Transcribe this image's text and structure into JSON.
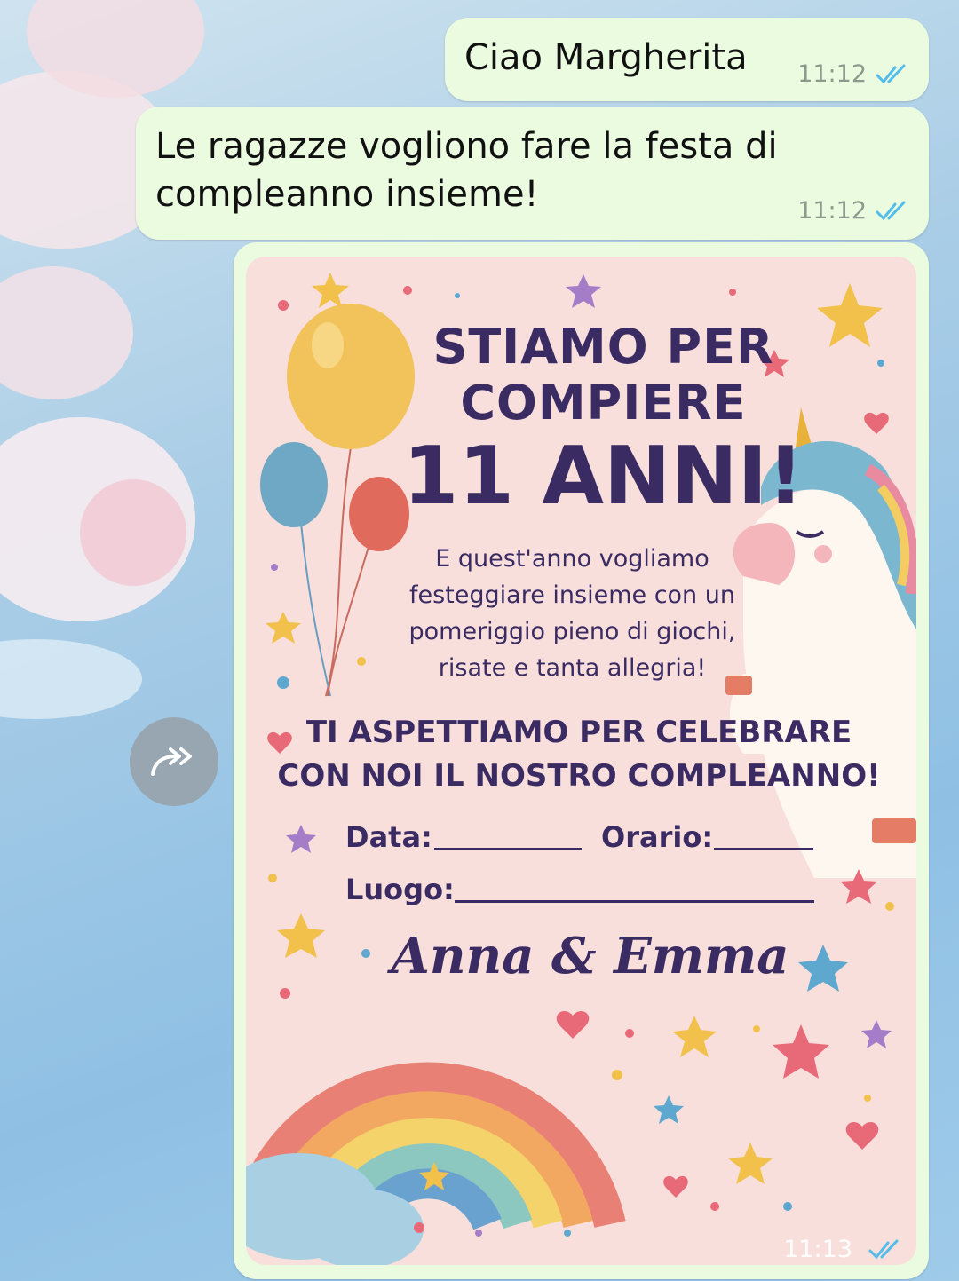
{
  "messages": [
    {
      "text": "Ciao Margherita",
      "time": "11:12",
      "status": "read"
    },
    {
      "text_line1": "Le ragazze vogliono fare la festa di",
      "text_line2": "compleanno insieme!",
      "time": "11:12",
      "status": "read"
    },
    {
      "type": "image",
      "time": "11:13",
      "status": "read"
    }
  ],
  "invite": {
    "title_line1": "STIAMO PER",
    "title_line2": "COMPIERE",
    "title_line3": "11 ANNI!",
    "body_lines": [
      "E quest'anno vogliamo",
      "festeggiare insieme con un",
      "pomeriggio pieno di giochi,",
      "risate e tanta allegria!"
    ],
    "celebrate_line1": "TI ASPETTIAMO PER CELEBRARE",
    "celebrate_line2": "CON NOI IL NOSTRO COMPLEANNO!",
    "data_label": "Data:",
    "orario_label": "Orario:",
    "luogo_label": "Luogo:",
    "names": "Anna & Emma"
  },
  "icons": {
    "forward": "forward-icon",
    "ticks": "double-check-icon"
  },
  "colors": {
    "bubble": "#eafbe0",
    "tick_read": "#53bdeb",
    "invite_text": "#3b2b63",
    "invite_bg": "#f8dfdc"
  }
}
